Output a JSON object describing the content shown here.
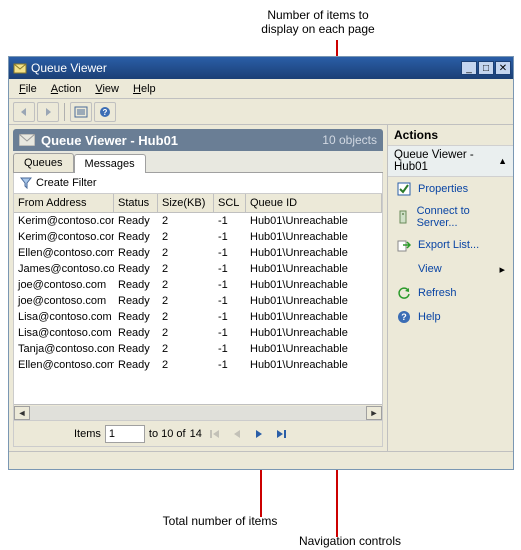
{
  "callouts": {
    "top": "Number of items to\ndisplay on each page",
    "bottom_left": "Total number of items",
    "bottom_right": "Navigation controls"
  },
  "window": {
    "title": "Queue Viewer",
    "menus": [
      "File",
      "Action",
      "View",
      "Help"
    ]
  },
  "panel": {
    "title": "Queue Viewer - Hub01",
    "object_count": "10 objects"
  },
  "tabs": {
    "queues": "Queues",
    "messages": "Messages"
  },
  "filter_label": "Create Filter",
  "columns": [
    "From Address",
    "Status",
    "Size(KB)",
    "SCL",
    "Queue ID"
  ],
  "rows": [
    {
      "from": "Kerim@contoso.com",
      "status": "Ready",
      "size": "2",
      "scl": "-1",
      "qid": "Hub01\\Unreachable"
    },
    {
      "from": "Kerim@contoso.com",
      "status": "Ready",
      "size": "2",
      "scl": "-1",
      "qid": "Hub01\\Unreachable"
    },
    {
      "from": "Ellen@contoso.com",
      "status": "Ready",
      "size": "2",
      "scl": "-1",
      "qid": "Hub01\\Unreachable"
    },
    {
      "from": "James@contoso.com",
      "status": "Ready",
      "size": "2",
      "scl": "-1",
      "qid": "Hub01\\Unreachable"
    },
    {
      "from": "joe@contoso.com",
      "status": "Ready",
      "size": "2",
      "scl": "-1",
      "qid": "Hub01\\Unreachable"
    },
    {
      "from": "joe@contoso.com",
      "status": "Ready",
      "size": "2",
      "scl": "-1",
      "qid": "Hub01\\Unreachable"
    },
    {
      "from": "Lisa@contoso.com",
      "status": "Ready",
      "size": "2",
      "scl": "-1",
      "qid": "Hub01\\Unreachable"
    },
    {
      "from": "Lisa@contoso.com",
      "status": "Ready",
      "size": "2",
      "scl": "-1",
      "qid": "Hub01\\Unreachable"
    },
    {
      "from": "Tanja@contoso.com",
      "status": "Ready",
      "size": "2",
      "scl": "-1",
      "qid": "Hub01\\Unreachable"
    },
    {
      "from": "Ellen@contoso.com",
      "status": "Ready",
      "size": "2",
      "scl": "-1",
      "qid": "Hub01\\Unreachable"
    }
  ],
  "pager": {
    "label_items": "Items",
    "current": "1",
    "to_label": "to 10 of",
    "total": "14"
  },
  "actions": {
    "title": "Actions",
    "subtitle": "Queue Viewer - Hub01",
    "items": {
      "properties": "Properties",
      "connect": "Connect to Server...",
      "export": "Export List...",
      "view": "View",
      "refresh": "Refresh",
      "help": "Help"
    }
  }
}
